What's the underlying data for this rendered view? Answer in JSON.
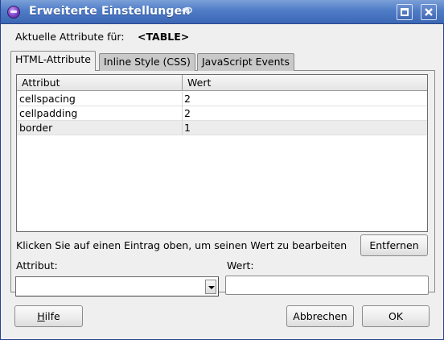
{
  "window": {
    "title": "Erweiterte Einstellungen"
  },
  "current": {
    "label": "Aktuelle Attribute für:",
    "element": "<TABLE>"
  },
  "tabs": [
    {
      "label": "HTML-Attribute",
      "active": true
    },
    {
      "label": "Inline Style (CSS)",
      "active": false
    },
    {
      "label": "JavaScript Events",
      "active": false
    }
  ],
  "table": {
    "columns": [
      "Attribut",
      "Wert"
    ],
    "rows": [
      {
        "attribute": "cellspacing",
        "value": "2"
      },
      {
        "attribute": "cellpadding",
        "value": "2"
      },
      {
        "attribute": "border",
        "value": "1"
      }
    ]
  },
  "hint": "Klicken Sie auf einen Eintrag oben, um seinen Wert zu bearbeiten",
  "buttons": {
    "remove": "Entfernen",
    "help_first": "H",
    "help_rest": "ilfe",
    "cancel": "Abbrechen",
    "ok": "OK"
  },
  "fields": {
    "attribute_label": "Attribut:",
    "attribute_value": "",
    "value_label": "Wert:",
    "value_value": ""
  },
  "colors": {
    "titlebar": "#4f7cc7",
    "dialog_bg": "#efefef"
  },
  "icons": {
    "app": "app-globe-icon",
    "title_decoration": "swirl-icon",
    "maximize": "maximize-icon",
    "close": "close-icon"
  }
}
